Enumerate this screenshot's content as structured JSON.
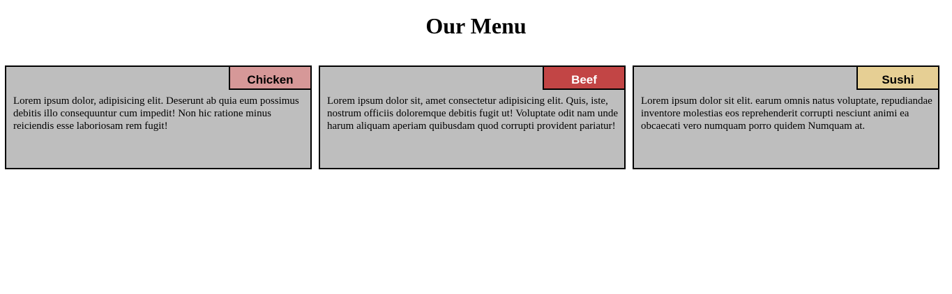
{
  "page": {
    "title": "Our Menu"
  },
  "menu": {
    "items": [
      {
        "label": "Chicken",
        "tag_color": "#d69898",
        "tag_text_color": "#000000",
        "description": "Lorem ipsum dolor, adipisicing elit. Deserunt ab quia eum possimus debitis illo consequuntur cum impedit! Non hic ratione minus reiciendis esse laboriosam rem fugit!"
      },
      {
        "label": "Beef",
        "tag_color": "#c24545",
        "tag_text_color": "#ffffff",
        "description": "Lorem ipsum dolor sit, amet consectetur adipisicing elit. Quis, iste, nostrum officiis doloremque debitis fugit ut! Voluptate odit nam unde harum aliquam aperiam quibusdam quod corrupti provident pariatur!"
      },
      {
        "label": "Sushi",
        "tag_color": "#e6cf94",
        "tag_text_color": "#000000",
        "description": "Lorem ipsum dolor sit elit. earum omnis natus voluptate, repudiandae inventore molestias eos reprehenderit corrupti nesciunt animi ea obcaecati vero numquam porro quidem Numquam at."
      }
    ],
    "card_background": "#bebebe"
  }
}
